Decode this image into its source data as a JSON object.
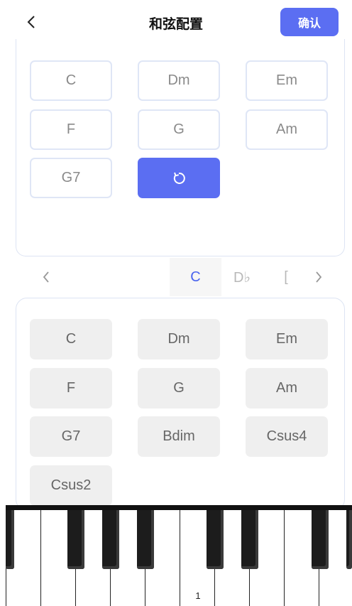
{
  "header": {
    "title": "和弦配置",
    "confirm_label": "确认"
  },
  "selected_chords": [
    "C",
    "Dm",
    "Em",
    "F",
    "G",
    "Am",
    "G7"
  ],
  "key_tabs": [
    {
      "label": "C",
      "active": true
    },
    {
      "label": "D♭",
      "active": false
    },
    {
      "label": "[",
      "active": false
    }
  ],
  "available_chords": [
    "C",
    "Dm",
    "Em",
    "F",
    "G",
    "Am",
    "G7",
    "Bdim",
    "Csus4",
    "Csus2"
  ],
  "piano": {
    "octave_label": "1"
  },
  "icons": {
    "back": "chevron-left-icon",
    "reset": "refresh-icon",
    "prev": "chevron-left-icon",
    "next": "chevron-right-icon"
  },
  "colors": {
    "accent": "#5b6ef2",
    "active_tab_text": "#4a64ee",
    "slot_border": "#dfe6f6",
    "option_bg": "#efefef"
  }
}
